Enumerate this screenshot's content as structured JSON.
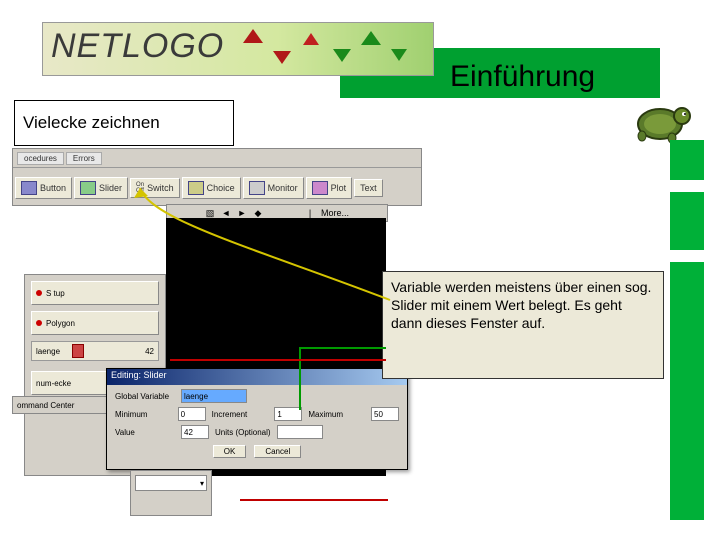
{
  "header": {
    "logo_text": "NETLOGO",
    "headline": "Einführung"
  },
  "subtitle": "Vielecke zeichnen",
  "toolbar": {
    "tabs": {
      "procedures": "ocedures",
      "errors": "Errors"
    },
    "buttons": {
      "button": "Button",
      "slider": "Slider",
      "switch": "Switch",
      "choice": "Choice",
      "monitor": "Monitor",
      "plot": "Plot",
      "text": "Text"
    },
    "switch_pre": "On\nOff"
  },
  "world_ctrl": {
    "more": "More..."
  },
  "left_panel": {
    "btn_setup": "S tup",
    "btn_polygon": "Polygon",
    "slider_label": "laenge",
    "slider_value": "42",
    "btn_numecke": "num-ecke"
  },
  "cmd_center": "ommand Center",
  "dialog": {
    "title": "Editing: Slider",
    "global_var_label": "Global Variable",
    "global_var_value": "laenge",
    "min_label": "Minimum",
    "min_value": "0",
    "inc_label": "Increment",
    "inc_value": "1",
    "max_label": "Maximum",
    "max_value": "50",
    "val_label": "Value",
    "val_value": "42",
    "units_label": "Units (Optional)",
    "ok": "OK",
    "cancel": "Cancel"
  },
  "callout": "Variable werden meistens über einen sog. Slider mit einem Wert belegt. Es geht dann dieses Fenster auf."
}
